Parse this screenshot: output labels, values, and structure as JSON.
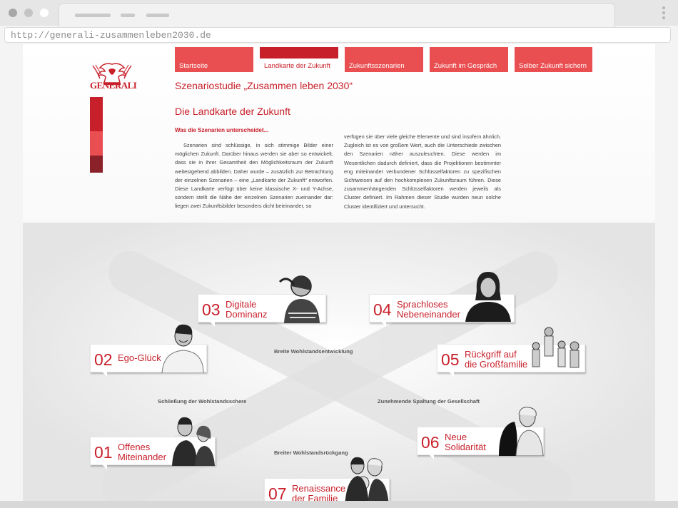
{
  "browser": {
    "url": "http://generali-zusammenleben2030.de",
    "window_dots": [
      "#a7a7a7",
      "#c4c4c4",
      "#ffffff"
    ]
  },
  "brand": {
    "logo_text": "GENERALI",
    "accent": "#c8202b",
    "light_accent": "#e94e51",
    "dark_accent": "#8a2128"
  },
  "nav": {
    "items": [
      {
        "label": "Startseite",
        "active": false
      },
      {
        "label": "Landkarte der Zukunft",
        "active": true
      },
      {
        "label": "Zukunftsszenarien",
        "active": false
      },
      {
        "label": "Zukunft im Gespräch",
        "active": false
      },
      {
        "label": "Selber Zukunft sichern",
        "active": false
      }
    ]
  },
  "header": {
    "study_title": "Szenariostudie „Zusammen leben 2030“",
    "page_title": "Die Landkarte der Zukunft",
    "section_title": "Was die Szenarien unterscheidet..."
  },
  "body": {
    "col1": "Szenarien sind schlüssige, in sich stimmige Bilder einer möglichen Zukunft. Darüber hinaus werden sie aber so entwickelt, dass sie in ihrer Gesamtheit den Möglichkeitsraum der Zukunft weitestgehend abbilden. Daher wurde – zusätzlich zur Betrachtung der einzelnen Szenarien – eine „Landkarte der Zukunft“ entworfen. Diese Landkarte verfügt über keine klassische X- und Y-Achse, sondern stellt die Nähe der einzelnen Szenarien zueinander dar: liegen zwei Zukunftsbilder besonders dicht beieinander, so",
    "col2": "verfügen sie über viele gleiche Elemente und sind insofern ähnlich. Zugleich ist es von großem Wert, auch die Unterschiede zwischen den Szenarien näher auszuleuchten. Diese werden im Wesentlichen dadurch definiert, dass die Projektionen bestimmter eng miteinander verbundener Schlüsselfaktoren zu spezifischen Sichtweisen auf den hochkomplexen Zukunftsraum führen. Diese zusammenhängenden Schlüsselfaktoren werden jeweils als Cluster definiert. Im Rahmen dieser Studie wurden neun solche Cluster identifiziert und untersucht."
  },
  "map": {
    "axes": {
      "top": "Breite Wohlstandsentwicklung",
      "left": "Schließung der Wohlstandsschere",
      "right": "Zunehmende Spaltung der Gesellschaft",
      "bottom": "Breiter Wohlstandsrückgang"
    },
    "scenarios": [
      {
        "num": "03",
        "label": "Digitale\nDominanz"
      },
      {
        "num": "04",
        "label": "Sprachloses\nNebeneinander"
      },
      {
        "num": "02",
        "label": "Ego-Glück"
      },
      {
        "num": "05",
        "label": "Rückgriff auf\ndie Großfamilie"
      },
      {
        "num": "01",
        "label": "Offenes\nMiteinander"
      },
      {
        "num": "06",
        "label": "Neue\nSolidarität"
      },
      {
        "num": "07",
        "label": "Renaissance\nder Familie"
      }
    ]
  }
}
